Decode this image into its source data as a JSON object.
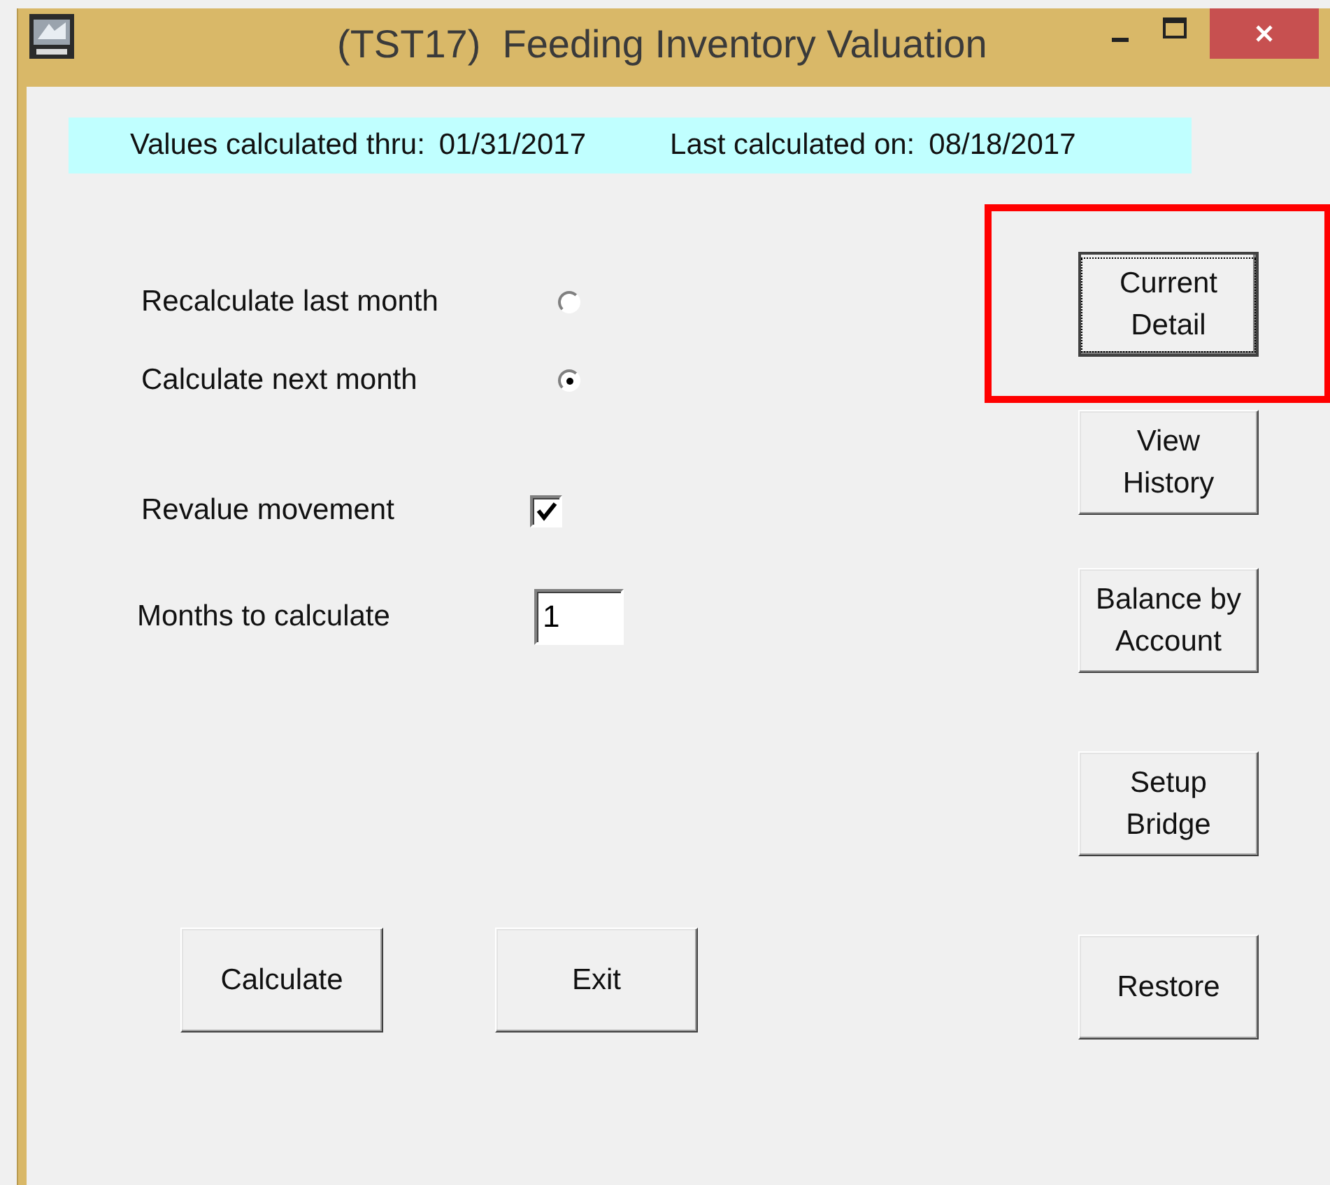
{
  "window": {
    "title": "(TST17)  Feeding Inventory Valuation"
  },
  "info": [
    {
      "label": "Values calculated thru:",
      "value": "01/31/2017"
    },
    {
      "label": "Last calculated on:",
      "value": "08/18/2017"
    }
  ],
  "options": [
    {
      "kind": "radio",
      "label": "Recalculate last month",
      "selected": false
    },
    {
      "kind": "radio",
      "label": "Calculate next month",
      "selected": true
    },
    {
      "kind": "checkbox",
      "label": "Revalue movement",
      "checked": true
    },
    {
      "kind": "number",
      "label": "Months to calculate",
      "value": "1"
    }
  ],
  "side_buttons": [
    {
      "label": "Current Detail",
      "focused": true,
      "highlighted": true
    },
    {
      "label": "View History",
      "focused": false,
      "highlighted": false
    },
    {
      "label": "Balance by Account",
      "focused": false,
      "highlighted": false
    },
    {
      "label": "Setup Bridge",
      "focused": false,
      "highlighted": false
    },
    {
      "label": "Restore",
      "focused": false,
      "highlighted": false
    }
  ],
  "bottom_buttons": [
    {
      "label": "Calculate"
    },
    {
      "label": "Exit"
    }
  ]
}
